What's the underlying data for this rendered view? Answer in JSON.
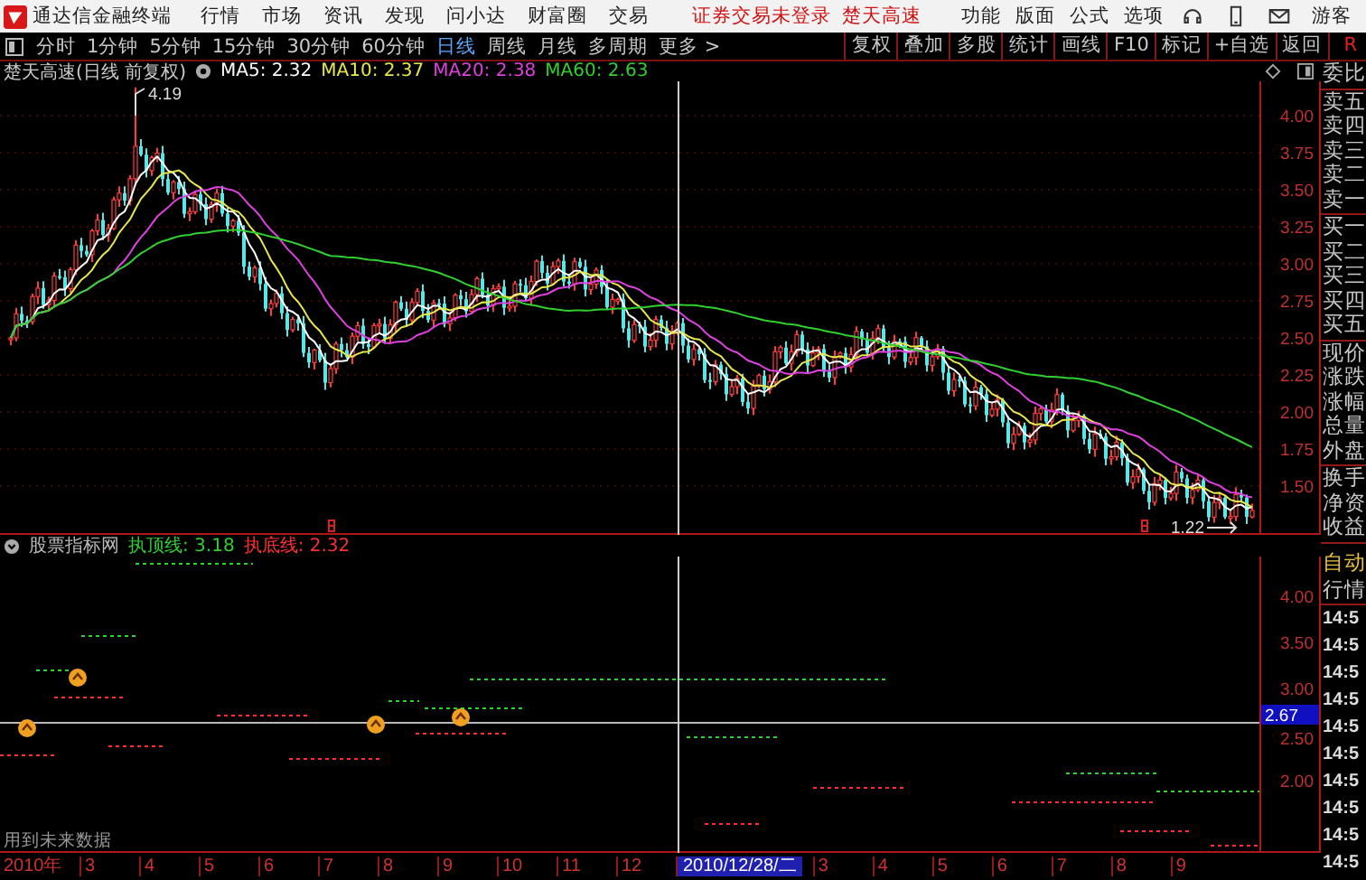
{
  "top_bar": {
    "app_title": "通达信金融终端",
    "menu": [
      "行情",
      "市场",
      "资讯",
      "发现",
      "问小达",
      "财富圈",
      "交易"
    ],
    "status": [
      "证券交易未登录",
      "楚天高速"
    ],
    "actions": [
      "功能",
      "版面",
      "公式",
      "选项"
    ],
    "user": "游客"
  },
  "toolbar": {
    "periods": [
      {
        "label": "分时",
        "selected": false
      },
      {
        "label": "1分钟",
        "selected": false
      },
      {
        "label": "5分钟",
        "selected": false
      },
      {
        "label": "15分钟",
        "selected": false
      },
      {
        "label": "30分钟",
        "selected": false
      },
      {
        "label": "60分钟",
        "selected": false
      },
      {
        "label": "日线",
        "selected": true
      },
      {
        "label": "周线",
        "selected": false
      },
      {
        "label": "月线",
        "selected": false
      },
      {
        "label": "多周期",
        "selected": false
      }
    ],
    "more": "更多 >",
    "buttons": [
      "复权",
      "叠加",
      "多股",
      "统计",
      "画线",
      "F10",
      "标记",
      "+自选",
      "返回"
    ],
    "end_label": "R"
  },
  "chart": {
    "title": "楚天高速(日线 前复权)",
    "ma": [
      {
        "label": "MA5: 2.32",
        "color": "#ffffff"
      },
      {
        "label": "MA10: 2.37",
        "color": "#e8e84a"
      },
      {
        "label": "MA20: 2.38",
        "color": "#e040e0"
      },
      {
        "label": "MA60: 2.63",
        "color": "#30d030"
      }
    ],
    "high_label": "4.19",
    "low_label": "1.22",
    "price_axis": [
      "4.00",
      "3.75",
      "3.50",
      "3.25",
      "3.00",
      "2.75",
      "2.50",
      "2.25",
      "2.00",
      "1.75",
      "1.50"
    ]
  },
  "indicator": {
    "name": "股票指标网",
    "lines": [
      {
        "label": "执顶线: 3.18",
        "color": "#30d030"
      },
      {
        "label": "执底线: 2.32",
        "color": "#ff3030"
      }
    ],
    "axis": [
      "4.00",
      "3.50",
      "3.00",
      "2.50",
      "2.00"
    ],
    "current": "2.67",
    "note": "用到未来数据"
  },
  "quote_panel": {
    "groups": [
      [
        "委比"
      ],
      [
        "卖五",
        "卖四",
        "卖三",
        "卖二",
        "卖一"
      ],
      [
        "买一",
        "买二",
        "买三",
        "买四",
        "买五"
      ],
      [
        "现价",
        "涨跌",
        "涨幅",
        "总量",
        "外盘"
      ],
      [
        "换手",
        "净资",
        "收益"
      ]
    ],
    "mode": "自动",
    "section": "行情",
    "times": [
      "14:5",
      "14:5",
      "14:5",
      "14:5",
      "14:5",
      "14:5",
      "14:5",
      "14:5",
      "14:5",
      "14:5"
    ]
  },
  "date_axis": [
    {
      "label": "2010年",
      "selected": false
    },
    {
      "label": "3",
      "selected": false
    },
    {
      "label": "4",
      "selected": false
    },
    {
      "label": "5",
      "selected": false
    },
    {
      "label": "6",
      "selected": false
    },
    {
      "label": "7",
      "selected": false
    },
    {
      "label": "8",
      "selected": false
    },
    {
      "label": "9",
      "selected": false
    },
    {
      "label": "10",
      "selected": false
    },
    {
      "label": "11",
      "selected": false
    },
    {
      "label": "12",
      "selected": false
    },
    {
      "label": "2010/12/28/二",
      "selected": true
    },
    {
      "label": "3",
      "selected": false
    },
    {
      "label": "4",
      "selected": false
    },
    {
      "label": "5",
      "selected": false
    },
    {
      "label": "6",
      "selected": false
    },
    {
      "label": "7",
      "selected": false
    },
    {
      "label": "8",
      "selected": false
    },
    {
      "label": "9",
      "selected": false
    }
  ]
}
